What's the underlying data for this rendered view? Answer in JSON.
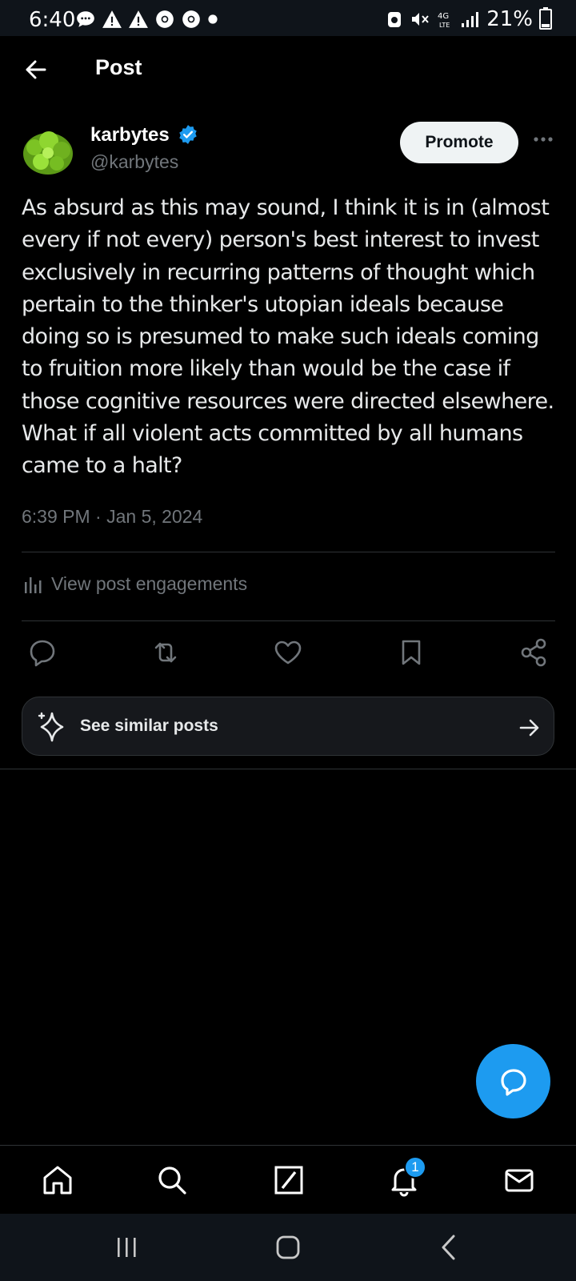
{
  "status_bar": {
    "time": "6:40",
    "battery_percent": "21%"
  },
  "header": {
    "title": "Post"
  },
  "post": {
    "display_name": "karbytes",
    "handle": "@karbytes",
    "promote_label": "Promote",
    "text": "As absurd as this may sound, I think it is in (almost every if not every) person's best interest to invest exclusively in recurring patterns of thought which pertain to the thinker's utopian ideals because doing so is presumed to make such ideals coming to fruition more likely than would be the case if those cognitive resources were directed elsewhere. What if all violent acts committed by all humans came to a halt?",
    "timestamp": "6:39 PM · Jan 5, 2024",
    "engagements_label": "View post engagements",
    "similar_label": "See similar posts"
  },
  "bottom_nav": {
    "notifications_badge": "1"
  },
  "colors": {
    "accent": "#1d9bf0",
    "background": "#000000",
    "muted": "#71767b"
  }
}
